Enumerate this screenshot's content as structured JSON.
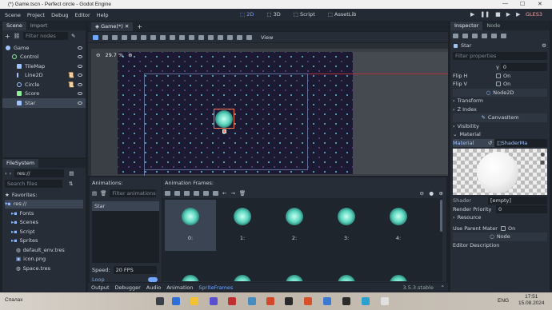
{
  "window": {
    "title": "(*) Game.tscn - Perfect circle - Godot Engine"
  },
  "menu": [
    "Scene",
    "Project",
    "Debug",
    "Editor",
    "Help"
  ],
  "workspaces": [
    "2D",
    "3D",
    "Script",
    "AssetLib"
  ],
  "renderer": "GLES3",
  "scene_dock": {
    "tabs": [
      "Scene",
      "Import"
    ],
    "filter_placeholder": "Filter nodes",
    "nodes": [
      {
        "label": "Game",
        "color": "#9fc3ff"
      },
      {
        "label": "Control",
        "color": "#8eef97"
      },
      {
        "label": "TileMap",
        "color": "#9fc3ff"
      },
      {
        "label": "Line2D",
        "color": "#9fc3ff"
      },
      {
        "label": "Circle",
        "color": "#9fc3ff"
      },
      {
        "label": "Score",
        "color": "#8eef97"
      },
      {
        "label": "Star",
        "color": "#9fc3ff"
      }
    ]
  },
  "filesystem": {
    "title": "FileSystem",
    "path": "res://",
    "search_placeholder": "Search files",
    "favorites": "Favorites:",
    "items": [
      {
        "label": "res://"
      },
      {
        "label": "Fonts"
      },
      {
        "label": "Scenes"
      },
      {
        "label": "Script"
      },
      {
        "label": "Sprites"
      },
      {
        "label": "default_env.tres"
      },
      {
        "label": "icon.png"
      },
      {
        "label": "Space.tres"
      }
    ]
  },
  "editor": {
    "tab": "Game(*)",
    "zoom": "29.7 %",
    "view_menu": "View"
  },
  "animations": {
    "title": "Animations:",
    "filter_placeholder": "Filter animations",
    "items": [
      "Star"
    ],
    "speed_label": "Speed:",
    "speed_value": "20 FPS",
    "loop_label": "Loop",
    "frames_title": "Animation Frames:",
    "frames": [
      "0:",
      "1:",
      "2:",
      "3:",
      "4:"
    ]
  },
  "bottom_tabs": [
    "Output",
    "Debugger",
    "Audio",
    "Animation",
    "SpriteFrames"
  ],
  "version": "3.5.3.stable",
  "inspector": {
    "tabs": [
      "Inspector",
      "Node"
    ],
    "node_name": "Star",
    "filter_placeholder": "Filter properties",
    "props": [
      {
        "label": "",
        "value": "0"
      },
      {
        "label": "Flip H",
        "value": "On"
      },
      {
        "label": "Flip V",
        "value": "On"
      }
    ],
    "section_node2d": "Node2D",
    "sub_transform": "Transform",
    "sub_zindex": "Z Index",
    "section_canvasitem": "CanvasItem",
    "sub_visibility": "Visibility",
    "sub_material": "Material",
    "material_label": "Material",
    "material_value": "ShaderMa",
    "shader_label": "Shader",
    "shader_value": "[empty]",
    "render_priority_label": "Render Priority",
    "render_priority_value": "0",
    "resource": "Resource",
    "use_parent_label": "Use Parent Mater",
    "use_parent_value": "On",
    "section_node": "Node",
    "editor_desc": "Editor Description"
  },
  "taskbar": {
    "search": "Спалах",
    "lang": "ENG",
    "time": "17:51",
    "date": "15.08.2024"
  }
}
